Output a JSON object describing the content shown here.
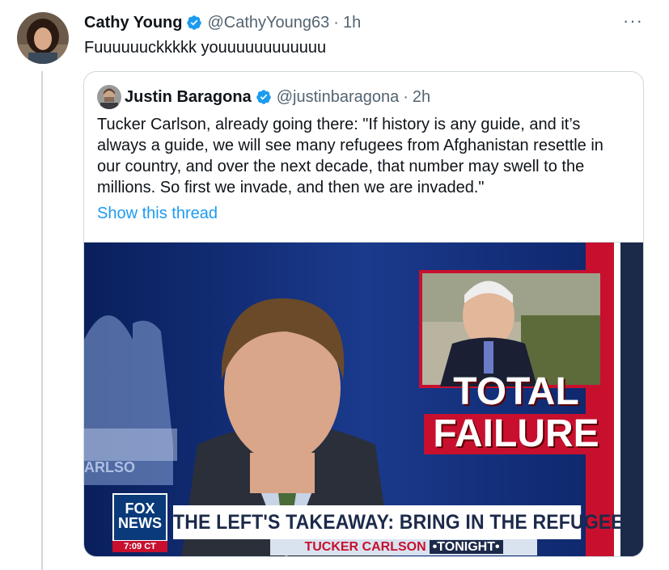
{
  "tweet": {
    "author_name": "Cathy Young",
    "handle": "@CathyYoung63",
    "time": "1h",
    "text": "Fuuuuuuckkkkk youuuuuuuuuuuu",
    "more": "···"
  },
  "quoted_tweet": {
    "author_name": "Justin Baragona",
    "handle": "@justinbaragona",
    "time": "2h",
    "text": "Tucker Carlson, already going there: \"If history is any guide, and it’s always a guide, we will see many refugees from Afghanistan resettle in our country, and over the next decade, that number may swell to the millions. So first we invade, and then we are invaded.\"",
    "show_thread": "Show this thread"
  },
  "media": {
    "chyron": "THE LEFT'S TAKEAWAY: BRING IN THE REFUGEES",
    "subchyron_show": "TUCKER CARLSON",
    "subchyron_tonight": "•TONIGHT•",
    "fox_logo": "FOX NEWS",
    "fox_time": "7:09 CT",
    "graphic_line1": "TOTAL",
    "graphic_line2": "FAILURE",
    "side_text": "ARLSO"
  },
  "colors": {
    "verified": "#1d9bf0",
    "link": "#1d9bf0",
    "muted": "#536471",
    "border": "#cfd9de"
  }
}
